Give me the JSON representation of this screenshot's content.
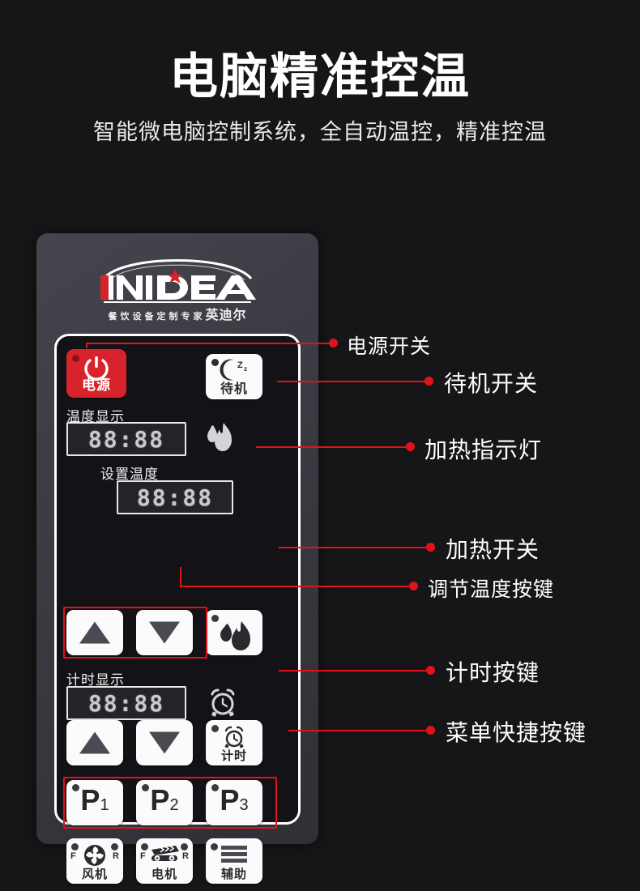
{
  "header": {
    "title": "电脑精准控温",
    "subtitle": "智能微电脑控制系统，全自动温控，精准控温"
  },
  "brand": {
    "wordmark": "INIDEA",
    "tagline": "餐饮设备定制专家",
    "chinese_name": "英迪尔"
  },
  "panel": {
    "power_key": {
      "label": "电源",
      "icon": "power-icon"
    },
    "standby_key": {
      "label": "待机",
      "icon": "moon-zz-icon",
      "zz": "Zz"
    },
    "temp_display": {
      "caption": "温度显示",
      "value": "88:88"
    },
    "set_temp": {
      "caption": "设置温度",
      "value": "88:88"
    },
    "timer_display": {
      "caption": "计时显示",
      "value": "88:88"
    },
    "heat_indicator_icon": "flame-icon",
    "heat_key": {
      "icon": "flame-icon"
    },
    "alarm_indicator_icon": "alarm-clock-icon",
    "timer_key": {
      "label": "计时",
      "icon": "alarm-clock-icon"
    },
    "temp_up_key": {
      "icon": "triangle-up-icon"
    },
    "temp_down_key": {
      "icon": "triangle-down-icon"
    },
    "timer_up_key": {
      "icon": "triangle-up-icon"
    },
    "timer_down_key": {
      "icon": "triangle-down-icon"
    },
    "presets": [
      {
        "letter": "P",
        "index": "1"
      },
      {
        "letter": "P",
        "index": "2"
      },
      {
        "letter": "P",
        "index": "3"
      }
    ],
    "functions": [
      {
        "label": "风机",
        "icon": "fan-blade-icon",
        "left_mark": "F",
        "right_mark": "R"
      },
      {
        "label": "电机",
        "icon": "conveyor-icon",
        "left_mark": "F",
        "right_mark": "R"
      },
      {
        "label": "辅助",
        "icon": "bars-icon"
      }
    ]
  },
  "callouts": [
    {
      "text": "电源开关"
    },
    {
      "text": "待机开关"
    },
    {
      "text": "加热指示灯"
    },
    {
      "text": "加热开关"
    },
    {
      "text": "调节温度按键"
    },
    {
      "text": "计时按键"
    },
    {
      "text": "菜单快捷按键"
    }
  ],
  "colors": {
    "accent_red": "#e1121c",
    "power_red": "#d8232c",
    "panel_gray": "#3c3c44",
    "panel_black": "#131317",
    "background": "#161618"
  }
}
